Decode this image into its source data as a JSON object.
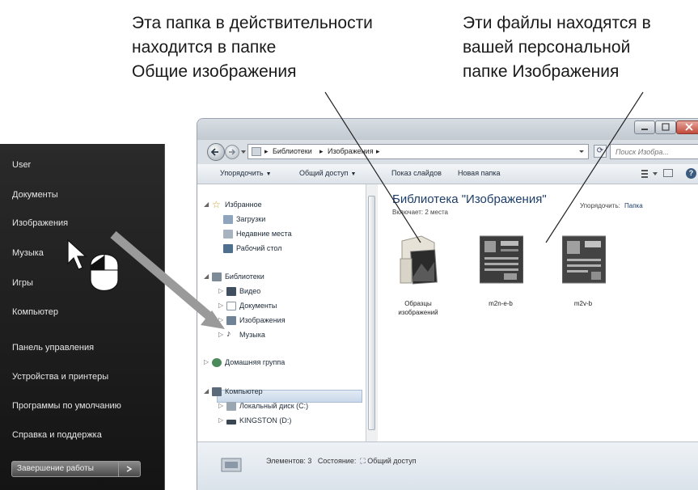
{
  "callouts": {
    "left": [
      "Эта папка в действительности",
      "находится в папке",
      "Общие изображения"
    ],
    "right": [
      "Эти файлы находятся в",
      "вашей персональной",
      "папке Изображения"
    ]
  },
  "start_menu": {
    "items": [
      "User",
      "Документы",
      "Изображения",
      "Музыка",
      "Игры",
      "Компьютер",
      "Панель управления",
      "Устройства и принтеры",
      "Программы по умолчанию",
      "Справка и поддержка"
    ],
    "shutdown_label": "Завершение работы"
  },
  "explorer": {
    "address": {
      "crumbs": [
        "Библиотеки",
        "Изображения"
      ],
      "search_placeholder": "Поиск Изобра..."
    },
    "toolbar": {
      "organize": "Упорядочить",
      "share": "Общий доступ",
      "slideshow": "Показ слайдов",
      "new_folder": "Новая папка"
    },
    "nav": {
      "favorites": {
        "label": "Избранное",
        "items": [
          "Загрузки",
          "Недавние места",
          "Рабочий стол"
        ]
      },
      "libraries": {
        "label": "Библиотеки",
        "items": [
          "Видео",
          "Документы",
          "Изображения",
          "Музыка"
        ]
      },
      "homegroup": "Домашняя группа",
      "computer": {
        "label": "Компьютер",
        "items": [
          "Локальный диск (C:)",
          "KINGSTON (D:)"
        ]
      }
    },
    "content": {
      "title": "Библиотека \"Изображения\"",
      "includes": "Включает: 2 места",
      "arrange_label": "Упорядочить:",
      "arrange_value": "Папка",
      "files": [
        {
          "name": "Образцы изображений",
          "icon": "folder-icon"
        },
        {
          "name": "m2n-e-b",
          "icon": "image-thumbnail"
        },
        {
          "name": "m2v-b",
          "icon": "image-thumbnail"
        }
      ]
    },
    "details": {
      "count_label": "Элементов: 3",
      "state_label": "Состояние:",
      "state_value": "Общий доступ"
    }
  },
  "colors": {
    "start_menu_bg": "#1c1c1c",
    "title_text": "#1e3e6a",
    "arrow": "#9a9a9a"
  }
}
